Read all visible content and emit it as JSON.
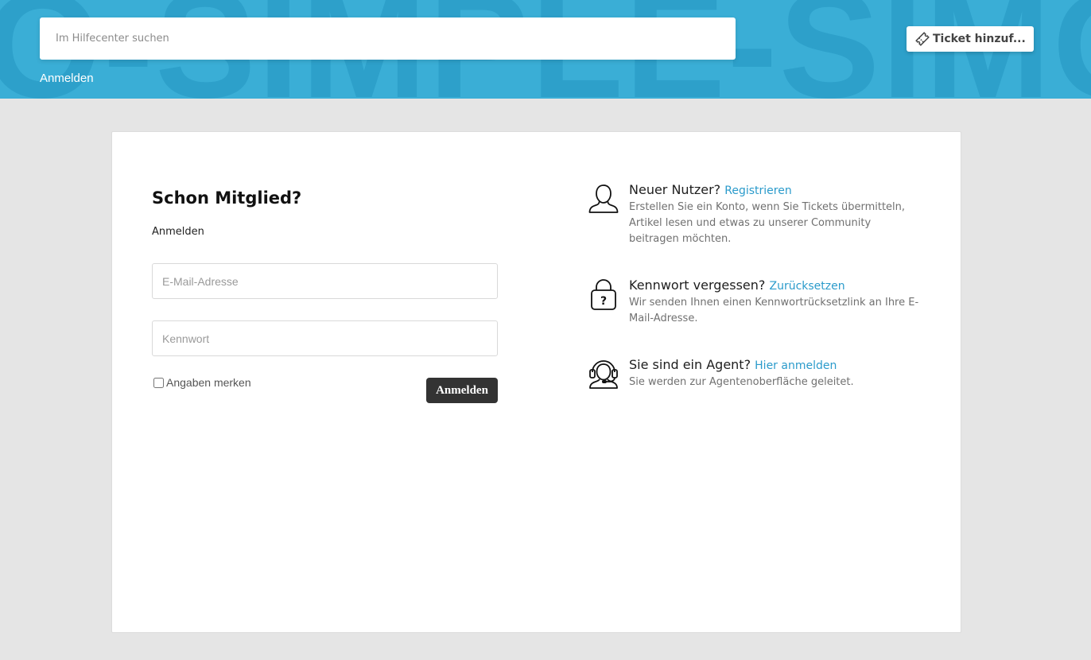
{
  "header": {
    "watermark": "O-SIMPLE-SIMO",
    "search_placeholder": "Im Hilfecenter suchen",
    "login_link": "Anmelden",
    "ticket_button": "Ticket hinzuf..."
  },
  "login": {
    "title": "Schon Mitglied?",
    "subtitle": "Anmelden",
    "email_placeholder": "E-Mail-Adresse",
    "email_value": "",
    "password_placeholder": "Kennwort",
    "password_value": "",
    "remember_label": "Angaben merken",
    "remember_checked": false,
    "submit_label": "Anmelden"
  },
  "info": {
    "register": {
      "icon": "user-icon",
      "heading": "Neuer Nutzer?",
      "link": "Registrieren",
      "text": "Erstellen Sie ein Konto, wenn Sie Tickets übermitteln, Artikel lesen und etwas zu unserer Community beitragen möchten."
    },
    "reset": {
      "icon": "lock-question-icon",
      "heading": "Kennwort vergessen?",
      "link": "Zurücksetzen",
      "text": "Wir senden Ihnen einen Kennwortrücksetzlink an Ihre E-Mail-Adresse."
    },
    "agent": {
      "icon": "headset-agent-icon",
      "heading": "Sie sind ein Agent?",
      "link": "Hier anmelden",
      "text": "Sie werden zur Agentenoberfläche geleitet."
    }
  },
  "colors": {
    "header_bg": "#3aaed6",
    "link": "#2b9bcb",
    "button_dark": "#333333",
    "page_bg": "#e5e5e5"
  }
}
